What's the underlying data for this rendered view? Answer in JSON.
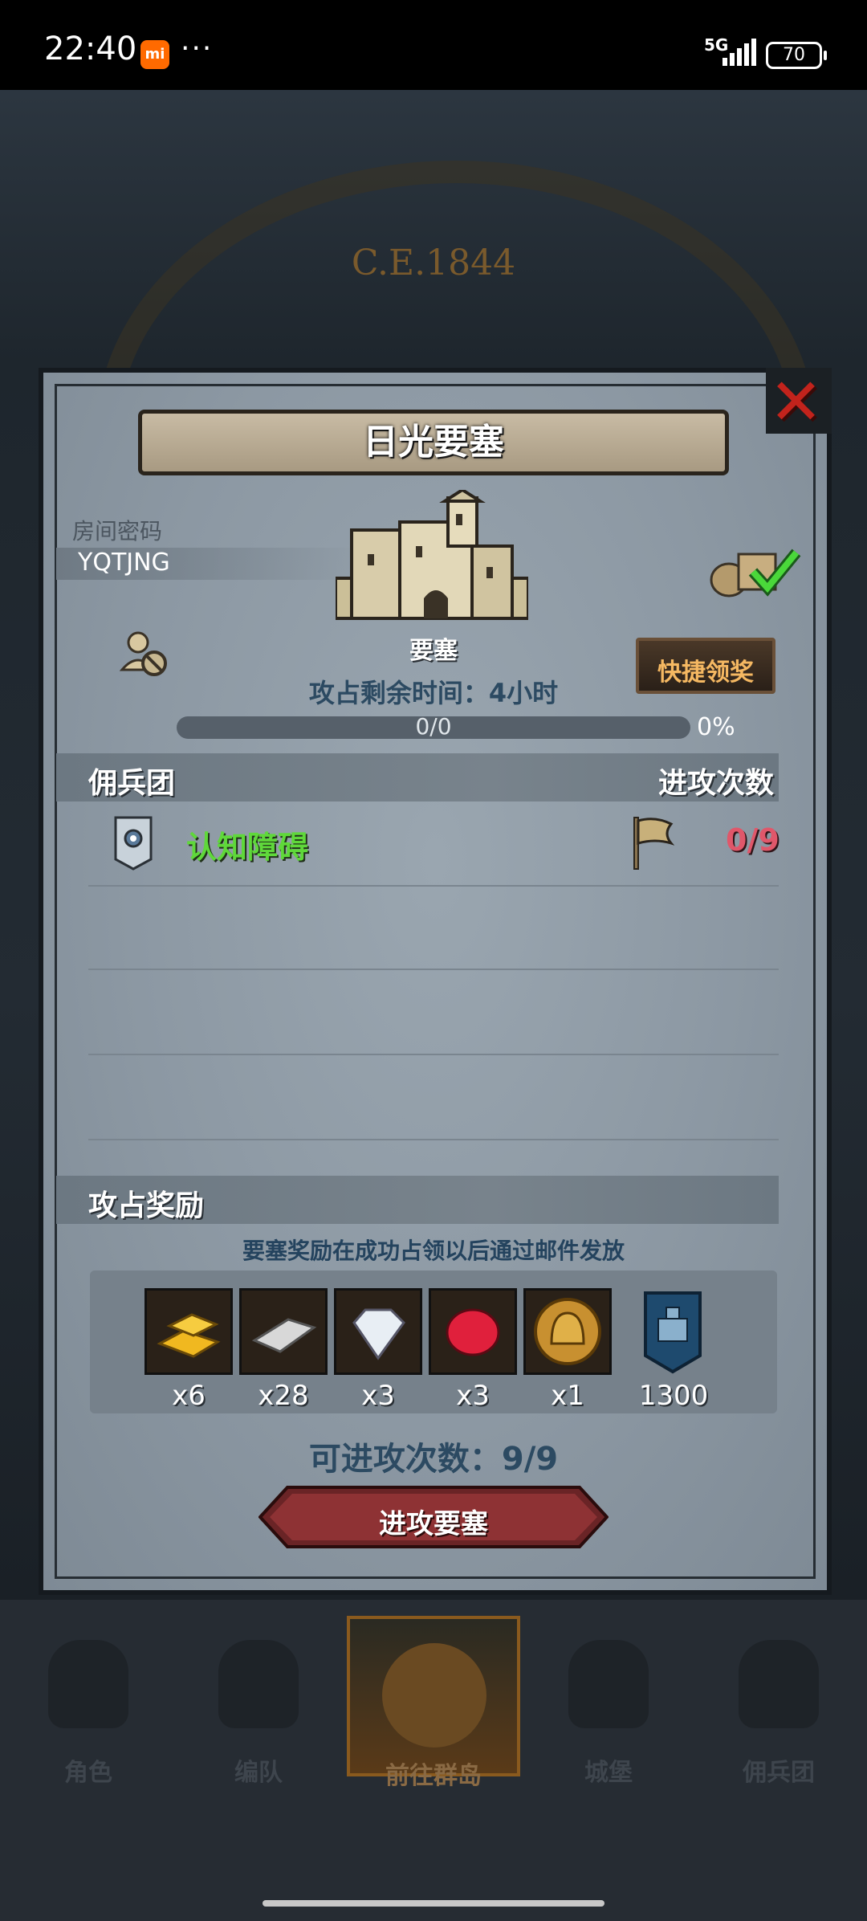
{
  "status_bar": {
    "time": "22:40",
    "app_badge": "mi",
    "more": "···",
    "network": "5G",
    "battery": "70"
  },
  "background": {
    "era": "C.E.1844"
  },
  "modal": {
    "title": "日光要塞",
    "close_icon": "close-x-icon",
    "room_label": "房间密码",
    "room_code": "YQTJNG",
    "fortress_label": "要塞",
    "quick_claim_label": "快捷领奖",
    "time_left": "攻占剩余时间：4小时",
    "progress": {
      "text": "0/0",
      "percent_text": "0%",
      "fraction": 0
    },
    "columns": {
      "guild": "佣兵团",
      "attacks": "进攻次数"
    },
    "guild_rows": [
      {
        "name": "认知障碍",
        "attacks": "0/9"
      }
    ],
    "reward_section_title": "攻占奖励",
    "reward_note": "要塞奖励在成功占领以后通过邮件发放",
    "rewards": [
      {
        "icon": "gold-bar-icon",
        "qty": "x6"
      },
      {
        "icon": "silver-bar-icon",
        "qty": "x28"
      },
      {
        "icon": "diamond-icon",
        "qty": "x3"
      },
      {
        "icon": "ruby-icon",
        "qty": "x3"
      },
      {
        "icon": "helmet-coin-icon",
        "qty": "x1"
      },
      {
        "icon": "fortress-token-icon",
        "qty": "1300"
      }
    ],
    "remaining_attacks": "可进攻次数：9/9",
    "attack_button": "进攻要塞"
  },
  "bottom_nav": {
    "items": [
      {
        "label": "角色",
        "icon": "knight-icon"
      },
      {
        "label": "编队",
        "icon": "formation-icon"
      },
      {
        "label": "前往群岛",
        "icon": "island-icon",
        "active": true
      },
      {
        "label": "城堡",
        "icon": "castle-icon"
      },
      {
        "label": "佣兵团",
        "icon": "mercenary-icon"
      }
    ]
  },
  "colors": {
    "close_red": "#c2231c",
    "guild_green": "#5fd83a",
    "count_red": "#e0576a",
    "quick_gold": "#f5b862"
  }
}
